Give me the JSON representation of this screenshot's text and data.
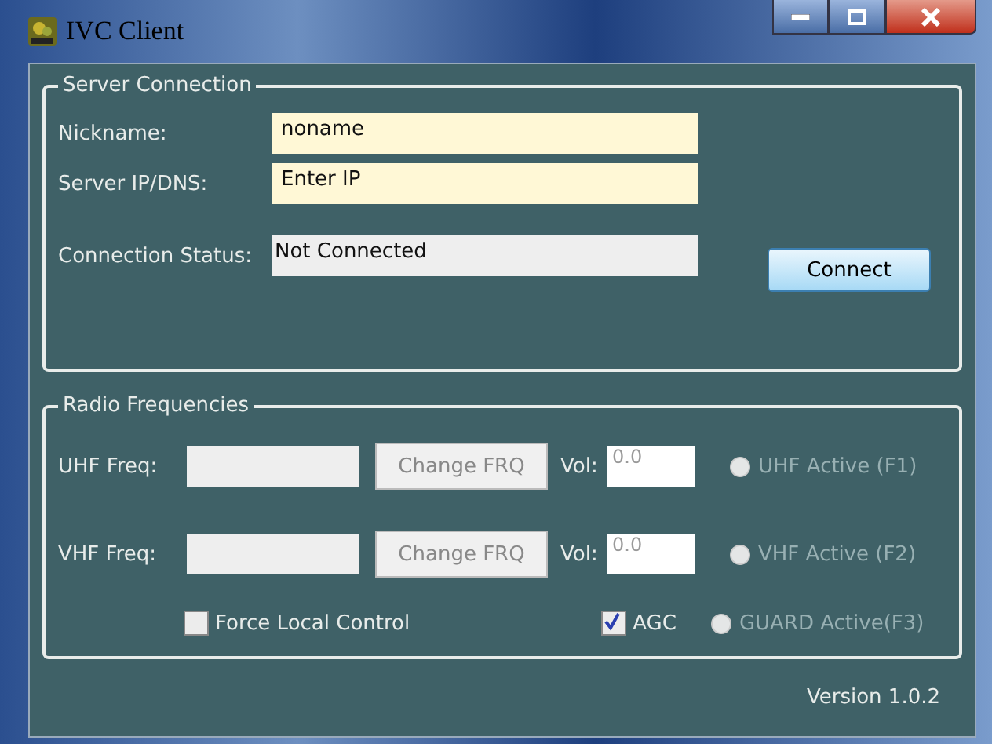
{
  "window": {
    "title": "IVC Client"
  },
  "server_connection": {
    "title": "Server Connection",
    "fields": [
      {
        "label": "Nickname:",
        "value": "noname",
        "kind": "input"
      },
      {
        "label": "Server IP/DNS:",
        "value": "Enter IP",
        "kind": "input"
      },
      {
        "label": "Connection Status:",
        "value": "Not Connected",
        "kind": "readonly"
      }
    ],
    "connect_button": "Connect"
  },
  "radio_frequencies": {
    "title": "Radio Frequencies",
    "rows": [
      {
        "label": "UHF Freq:",
        "button": "Change FRQ",
        "vol_label": "Vol:",
        "vol_value": "0.0",
        "radio": {
          "label": "UHF Active (F1)",
          "selected": false,
          "disabled": true
        }
      },
      {
        "label": "VHF Freq:",
        "button": "Change FRQ",
        "vol_label": "Vol:",
        "vol_value": "0.0",
        "radio": {
          "label": "VHF Active (F2)",
          "selected": false,
          "disabled": true
        }
      }
    ],
    "checks": [
      {
        "label": "Force Local Control",
        "checked": false
      },
      {
        "label": "AGC",
        "checked": true
      }
    ],
    "guard": {
      "label": "GUARD Active(F3)",
      "selected": false,
      "disabled": true
    }
  },
  "version": "Version 1.0.2"
}
